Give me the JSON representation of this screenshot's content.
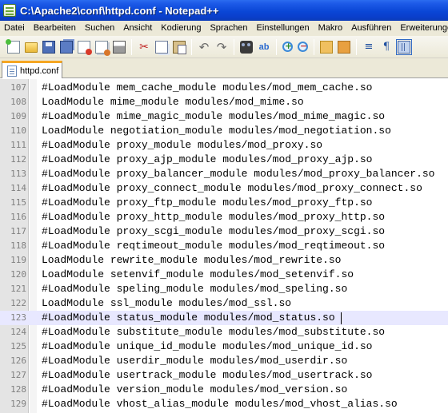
{
  "window": {
    "title": "C:\\Apache2\\conf\\httpd.conf - Notepad++",
    "title_bar_color": "#0a46d6"
  },
  "menu": [
    "Datei",
    "Bearbeiten",
    "Suchen",
    "Ansicht",
    "Kodierung",
    "Sprachen",
    "Einstellungen",
    "Makro",
    "Ausführen",
    "Erweiterungen"
  ],
  "toolbar_icons": [
    "new-file-icon",
    "open-file-icon",
    "save-icon",
    "save-all-icon",
    "close-icon",
    "close-all-icon",
    "print-icon",
    "cut-icon",
    "copy-icon",
    "paste-icon",
    "undo-icon",
    "redo-icon",
    "find-icon",
    "replace-icon",
    "zoom-in-icon",
    "zoom-out-icon",
    "sync-vertical-icon",
    "sync-horizontal-icon",
    "word-wrap-icon",
    "show-all-chars-icon",
    "indent-guide-icon"
  ],
  "tab": {
    "label": "httpd.conf",
    "accent_color": "#f5a623"
  },
  "editor": {
    "current_line": 123,
    "current_line_color": "#e8e8ff",
    "lines": [
      {
        "number": "107",
        "text": "#LoadModule mem_cache_module modules/mod_mem_cache.so"
      },
      {
        "number": "108",
        "text": "LoadModule mime_module modules/mod_mime.so"
      },
      {
        "number": "109",
        "text": "#LoadModule mime_magic_module modules/mod_mime_magic.so"
      },
      {
        "number": "110",
        "text": "LoadModule negotiation_module modules/mod_negotiation.so"
      },
      {
        "number": "111",
        "text": "#LoadModule proxy_module modules/mod_proxy.so"
      },
      {
        "number": "112",
        "text": "#LoadModule proxy_ajp_module modules/mod_proxy_ajp.so"
      },
      {
        "number": "113",
        "text": "#LoadModule proxy_balancer_module modules/mod_proxy_balancer.so"
      },
      {
        "number": "114",
        "text": "#LoadModule proxy_connect_module modules/mod_proxy_connect.so"
      },
      {
        "number": "115",
        "text": "#LoadModule proxy_ftp_module modules/mod_proxy_ftp.so"
      },
      {
        "number": "116",
        "text": "#LoadModule proxy_http_module modules/mod_proxy_http.so"
      },
      {
        "number": "117",
        "text": "#LoadModule proxy_scgi_module modules/mod_proxy_scgi.so"
      },
      {
        "number": "118",
        "text": "#LoadModule reqtimeout_module modules/mod_reqtimeout.so"
      },
      {
        "number": "119",
        "text": "LoadModule rewrite_module modules/mod_rewrite.so"
      },
      {
        "number": "120",
        "text": "LoadModule setenvif_module modules/mod_setenvif.so"
      },
      {
        "number": "121",
        "text": "#LoadModule speling_module modules/mod_speling.so"
      },
      {
        "number": "122",
        "text": "LoadModule ssl_module modules/mod_ssl.so"
      },
      {
        "number": "123",
        "text": "#LoadModule status_module modules/mod_status.so"
      },
      {
        "number": "124",
        "text": "#LoadModule substitute_module modules/mod_substitute.so"
      },
      {
        "number": "125",
        "text": "#LoadModule unique_id_module modules/mod_unique_id.so"
      },
      {
        "number": "126",
        "text": "#LoadModule userdir_module modules/mod_userdir.so"
      },
      {
        "number": "127",
        "text": "#LoadModule usertrack_module modules/mod_usertrack.so"
      },
      {
        "number": "128",
        "text": "#LoadModule version_module modules/mod_version.so"
      },
      {
        "number": "129",
        "text": "#LoadModule vhost_alias_module modules/mod_vhost_alias.so"
      }
    ]
  }
}
